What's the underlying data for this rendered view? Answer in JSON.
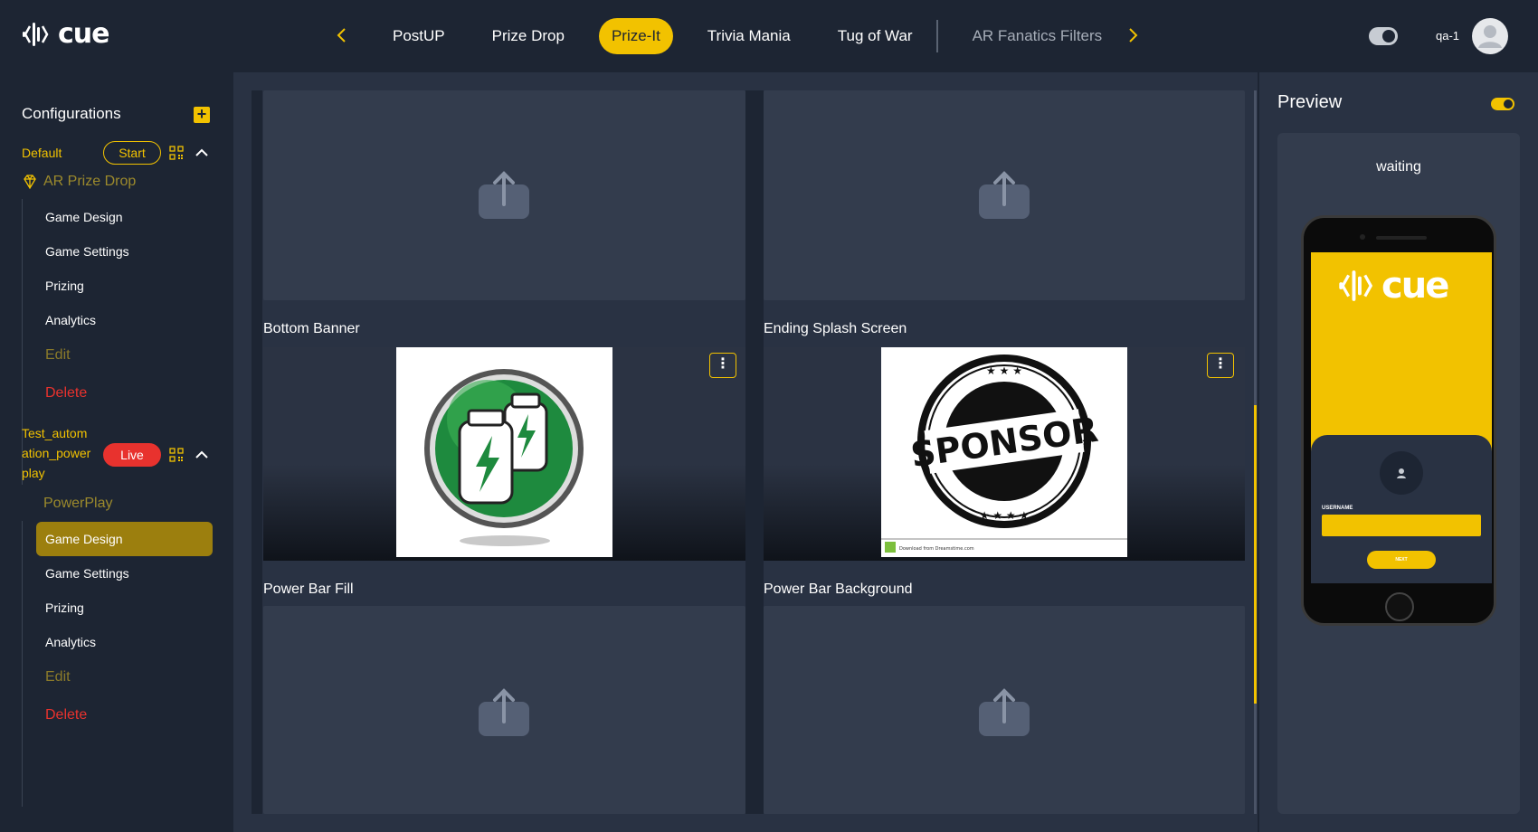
{
  "header": {
    "tabs": [
      {
        "label": "PostUP"
      },
      {
        "label": "Prize Drop"
      },
      {
        "label": "Prize-It"
      },
      {
        "label": "Trivia Mania"
      },
      {
        "label": "Tug of War"
      },
      {
        "label": "AR Fanatics Filters"
      }
    ],
    "active_tab": "Prize-It",
    "user": "qa-1",
    "logo_text": "cue"
  },
  "sidebar": {
    "title": "Configurations",
    "configs": [
      {
        "name": "Default",
        "status": "Start",
        "game": "AR Prize Drop",
        "items": [
          "Game Design",
          "Game Settings",
          "Prizing",
          "Analytics"
        ],
        "edit": "Edit",
        "delete": "Delete"
      },
      {
        "name_lines": [
          "Test_autom",
          "ation_power",
          "play"
        ],
        "status": "Live",
        "game": "PowerPlay",
        "items": [
          "Game Design",
          "Game Settings",
          "Prizing",
          "Analytics"
        ],
        "active_item": "Game Design",
        "edit": "Edit",
        "delete": "Delete"
      }
    ]
  },
  "main": {
    "assets": [
      {
        "label": "Bottom Banner"
      },
      {
        "label": "Ending Splash Screen",
        "image_text": "SPONSOR",
        "footer_text": "Download from Dreamstime.com"
      },
      {
        "label": "Power Bar Fill"
      },
      {
        "label": "Power Bar Background"
      }
    ]
  },
  "preview": {
    "title": "Preview",
    "status": "waiting",
    "phone": {
      "logo_text": "cue",
      "username_label": "USERNAME",
      "button_label": "NEXT"
    }
  },
  "colors": {
    "accent": "#f2c200",
    "live": "#e8322e",
    "background": "#1d2533",
    "panel": "#293243"
  }
}
